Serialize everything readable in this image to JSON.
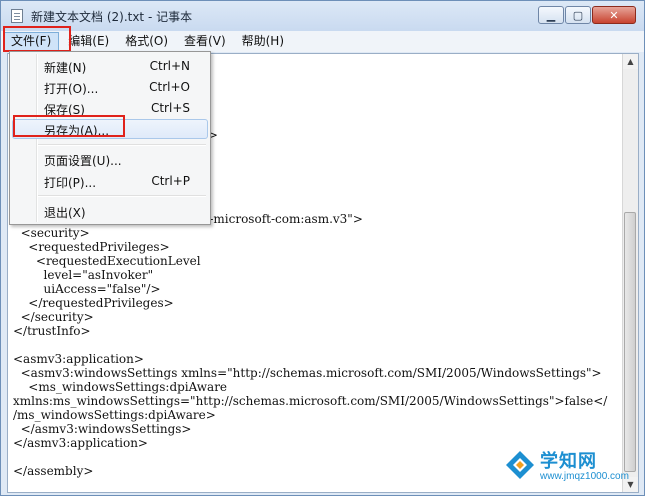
{
  "window": {
    "title": "新建文本文档 (2).txt - 记事本",
    "caption": {
      "minimize": "▁",
      "maximize": "▢",
      "close": "✕"
    }
  },
  "menubar": {
    "items": [
      {
        "label": "文件(F)"
      },
      {
        "label": "编辑(E)"
      },
      {
        "label": "格式(O)"
      },
      {
        "label": "查看(V)"
      },
      {
        "label": "帮助(H)"
      }
    ]
  },
  "file_menu": {
    "items": [
      {
        "label": "新建(N)",
        "shortcut": "Ctrl+N"
      },
      {
        "label": "打开(O)...",
        "shortcut": "Ctrl+O"
      },
      {
        "label": "保存(S)",
        "shortcut": "Ctrl+S"
      },
      {
        "label": "另存为(A)...",
        "shortcut": ""
      },
      {
        "label": "页面设置(U)...",
        "shortcut": ""
      },
      {
        "label": "打印(P)...",
        "shortcut": "Ctrl+P"
      },
      {
        "label": "退出(X)",
        "shortcut": ""
      }
    ],
    "highlighted": "另存为(A)..."
  },
  "editor": {
    "lines": [
      "",
      "",
      "                              XT\"",
      "",
      "                              \"amd64\"",
      "                              b9a1e18e3b\">",
      "",
      "",
      "",
      "",
      "",
      "<trustInfo xmlns=\"urn:schemas-microsoft-com:asm.v3\">",
      "  <security>",
      "    <requestedPrivileges>",
      "      <requestedExecutionLevel",
      "        level=\"asInvoker\"",
      "        uiAccess=\"false\"/>",
      "    </requestedPrivileges>",
      "  </security>",
      "</trustInfo>",
      "",
      "<asmv3:application>",
      "  <asmv3:windowsSettings xmlns=\"http://schemas.microsoft.com/SMI/2005/WindowsSettings\">",
      "    <ms_windowsSettings:dpiAware",
      "xmlns:ms_windowsSettings=\"http://schemas.microsoft.com/SMI/2005/WindowsSettings\">false</",
      "/ms_windowsSettings:dpiAware>",
      "  </asmv3:windowsSettings>",
      "</asmv3:application>",
      "",
      "</assembly>"
    ]
  },
  "watermark": {
    "title": "学知网",
    "url": "www.jmqz1000.com"
  },
  "colors": {
    "highlight_red": "#e0221b",
    "watermark_blue": "#1d8fd1"
  }
}
